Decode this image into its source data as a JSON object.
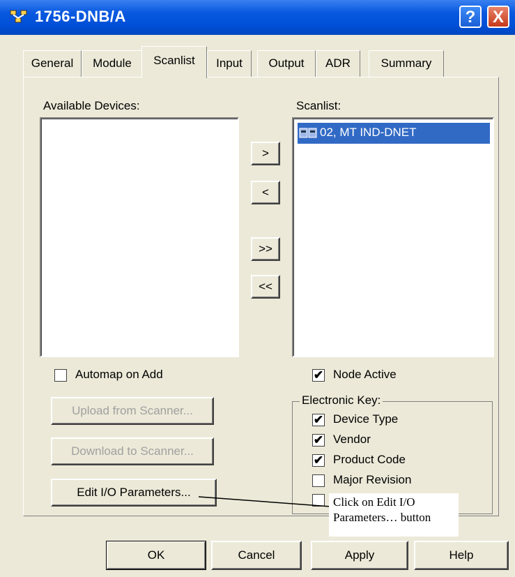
{
  "window": {
    "title": "1756-DNB/A",
    "help_glyph": "?",
    "close_glyph": "X"
  },
  "tabs": [
    {
      "label": "General"
    },
    {
      "label": "Module"
    },
    {
      "label": "Scanlist"
    },
    {
      "label": "Input"
    },
    {
      "label": "Output"
    },
    {
      "label": "ADR"
    },
    {
      "label": "Summary"
    }
  ],
  "scanlist_tab": {
    "available_devices_label": "Available Devices:",
    "scanlist_label": "Scanlist:",
    "scanlist_items": [
      "02, MT IND-DNET"
    ],
    "move_right_label": ">",
    "move_left_label": "<",
    "move_all_right_label": ">>",
    "move_all_left_label": "<<",
    "automap_label": "Automap on Add",
    "automap_checked": false,
    "upload_label": "Upload from Scanner...",
    "download_label": "Download to Scanner...",
    "edit_io_label": "Edit I/O Parameters...",
    "node_active_label": "Node Active",
    "node_active_checked": true,
    "electronic_key_label": "Electronic Key:",
    "device_type_label": "Device Type",
    "vendor_label": "Vendor",
    "product_code_label": "Product Code",
    "major_revision_label": "Major Revision"
  },
  "callout": {
    "line1": "Click on Edit I/O",
    "line2": "Parameters… button"
  },
  "footer": {
    "ok_label": "OK",
    "cancel_label": "Cancel",
    "apply_label": "Apply",
    "help_label": "Help"
  },
  "colors": {
    "title_bar": "#0a5ae0",
    "dialog_bg": "#ece9d8",
    "selection": "#316ac5"
  }
}
